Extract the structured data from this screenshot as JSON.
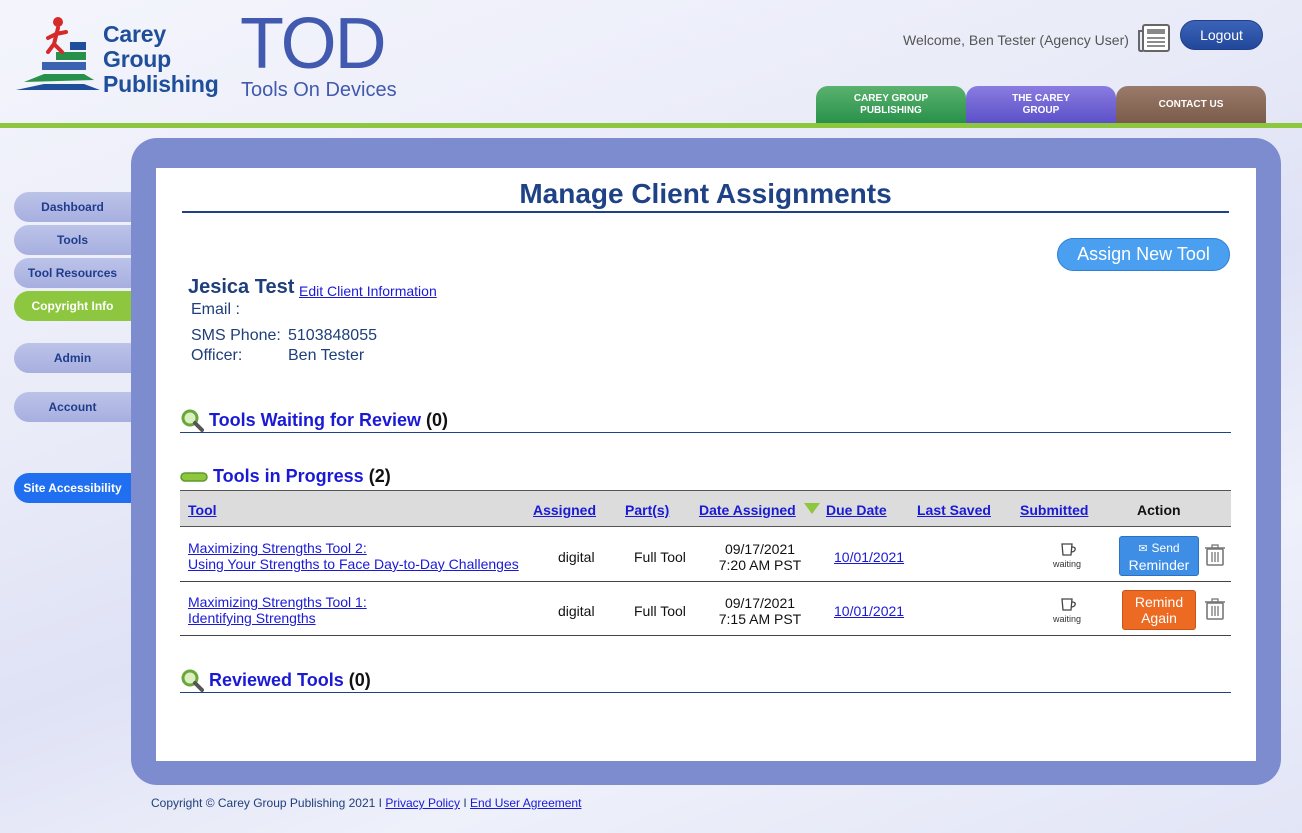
{
  "header": {
    "logo_lines": [
      "Carey",
      "Group",
      "Publishing"
    ],
    "app_title": "TOD",
    "app_subtitle": "Tools On Devices",
    "welcome": "Welcome, Ben Tester (Agency User)",
    "logout_label": "Logout",
    "tabs": [
      {
        "line1": "CAREY GROUP",
        "line2": "PUBLISHING"
      },
      {
        "line1": "THE CAREY",
        "line2": "GROUP"
      },
      {
        "line1": "CONTACT US",
        "line2": ""
      }
    ]
  },
  "sidebar": {
    "items": [
      {
        "label": "Dashboard"
      },
      {
        "label": "Tools"
      },
      {
        "label": "Tool Resources"
      },
      {
        "label": "Copyright Info"
      },
      {
        "label": "Admin"
      },
      {
        "label": "Account"
      },
      {
        "label": "Site Accessibility"
      }
    ]
  },
  "main": {
    "title": "Manage Client Assignments",
    "assign_button": "Assign New Tool",
    "client": {
      "name": "Jesica Test",
      "edit_link": "Edit Client Information",
      "email_label": "Email :",
      "email_value": "",
      "sms_label": "SMS Phone:",
      "sms_value": "5103848055",
      "officer_label": "Officer:",
      "officer_value": "Ben Tester"
    },
    "sections": {
      "waiting": {
        "title": "Tools Waiting for Review",
        "count": "(0)"
      },
      "in_progress": {
        "title": "Tools in Progress",
        "count": "(2)"
      },
      "reviewed": {
        "title": "Reviewed Tools",
        "count": "(0)"
      }
    },
    "table": {
      "headers": [
        "Tool",
        "Assigned",
        "Part(s)",
        "Date Assigned",
        "Due Date",
        "Last Saved",
        "Submitted",
        "Action"
      ],
      "rows": [
        {
          "tool_line1": "Maximizing Strengths Tool 2:",
          "tool_line2": "Using Your Strengths to Face Day-to-Day Challenges",
          "assigned": "digital",
          "parts": "Full Tool",
          "date_line1": "09/17/2021",
          "date_line2": "7:20 AM PST",
          "due": "10/01/2021",
          "last_saved": "",
          "submitted": "waiting",
          "action_line1": "Send",
          "action_line2": "Reminder"
        },
        {
          "tool_line1": "Maximizing Strengths Tool 1:",
          "tool_line2": "Identifying Strengths",
          "assigned": "digital",
          "parts": "Full Tool",
          "date_line1": "09/17/2021",
          "date_line2": "7:15 AM PST",
          "due": "10/01/2021",
          "last_saved": "",
          "submitted": "waiting",
          "action_line1": "Remind",
          "action_line2": "Again"
        }
      ]
    }
  },
  "footer": {
    "copyright": "Copyright © Carey Group Publishing 2021 I",
    "privacy": "Privacy Policy",
    "sep": "I",
    "eula": "End User Agreement"
  },
  "colors": {
    "brand_blue": "#1f4287",
    "accent_green": "#8dc63f",
    "panel_blue": "#7d8ccf",
    "link_blue": "#1a1ad6",
    "reminder_blue": "#3f8ee6",
    "remind_orange": "#ec6a22"
  }
}
